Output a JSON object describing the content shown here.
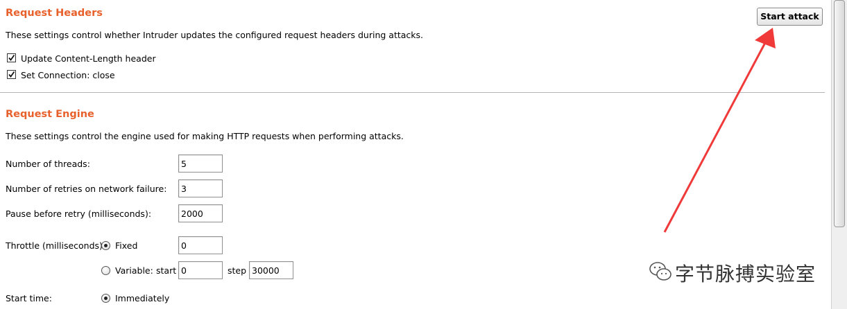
{
  "request_headers": {
    "title": "Request Headers",
    "description": "These settings control whether Intruder updates the configured request headers during attacks.",
    "options": [
      {
        "label": "Update Content-Length header",
        "checked": true
      },
      {
        "label": "Set Connection: close",
        "checked": true
      }
    ]
  },
  "toolbar": {
    "start_attack_label": "Start attack"
  },
  "request_engine": {
    "title": "Request Engine",
    "description": "These settings control the engine used for making HTTP requests when performing attacks.",
    "threads": {
      "label": "Number of threads:",
      "value": "5"
    },
    "retries": {
      "label": "Number of retries on network failure:",
      "value": "3"
    },
    "pause": {
      "label": "Pause before retry (milliseconds):",
      "value": "2000"
    },
    "throttle": {
      "label": "Throttle (milliseconds):",
      "fixed_label": "Fixed",
      "fixed_selected": true,
      "fixed_value": "0",
      "variable_label": "Variable:",
      "variable_selected": false,
      "start_label": "start",
      "start_value": "0",
      "step_label": "step",
      "step_value": "30000"
    },
    "start_time": {
      "label": "Start time:",
      "immediately_label": "Immediately",
      "immediately_selected": true
    }
  },
  "annotation": {
    "arrow_color": "#f03a3a"
  },
  "watermark": {
    "text": "字节脉搏实验室"
  },
  "colors": {
    "heading": "#e8612c"
  }
}
